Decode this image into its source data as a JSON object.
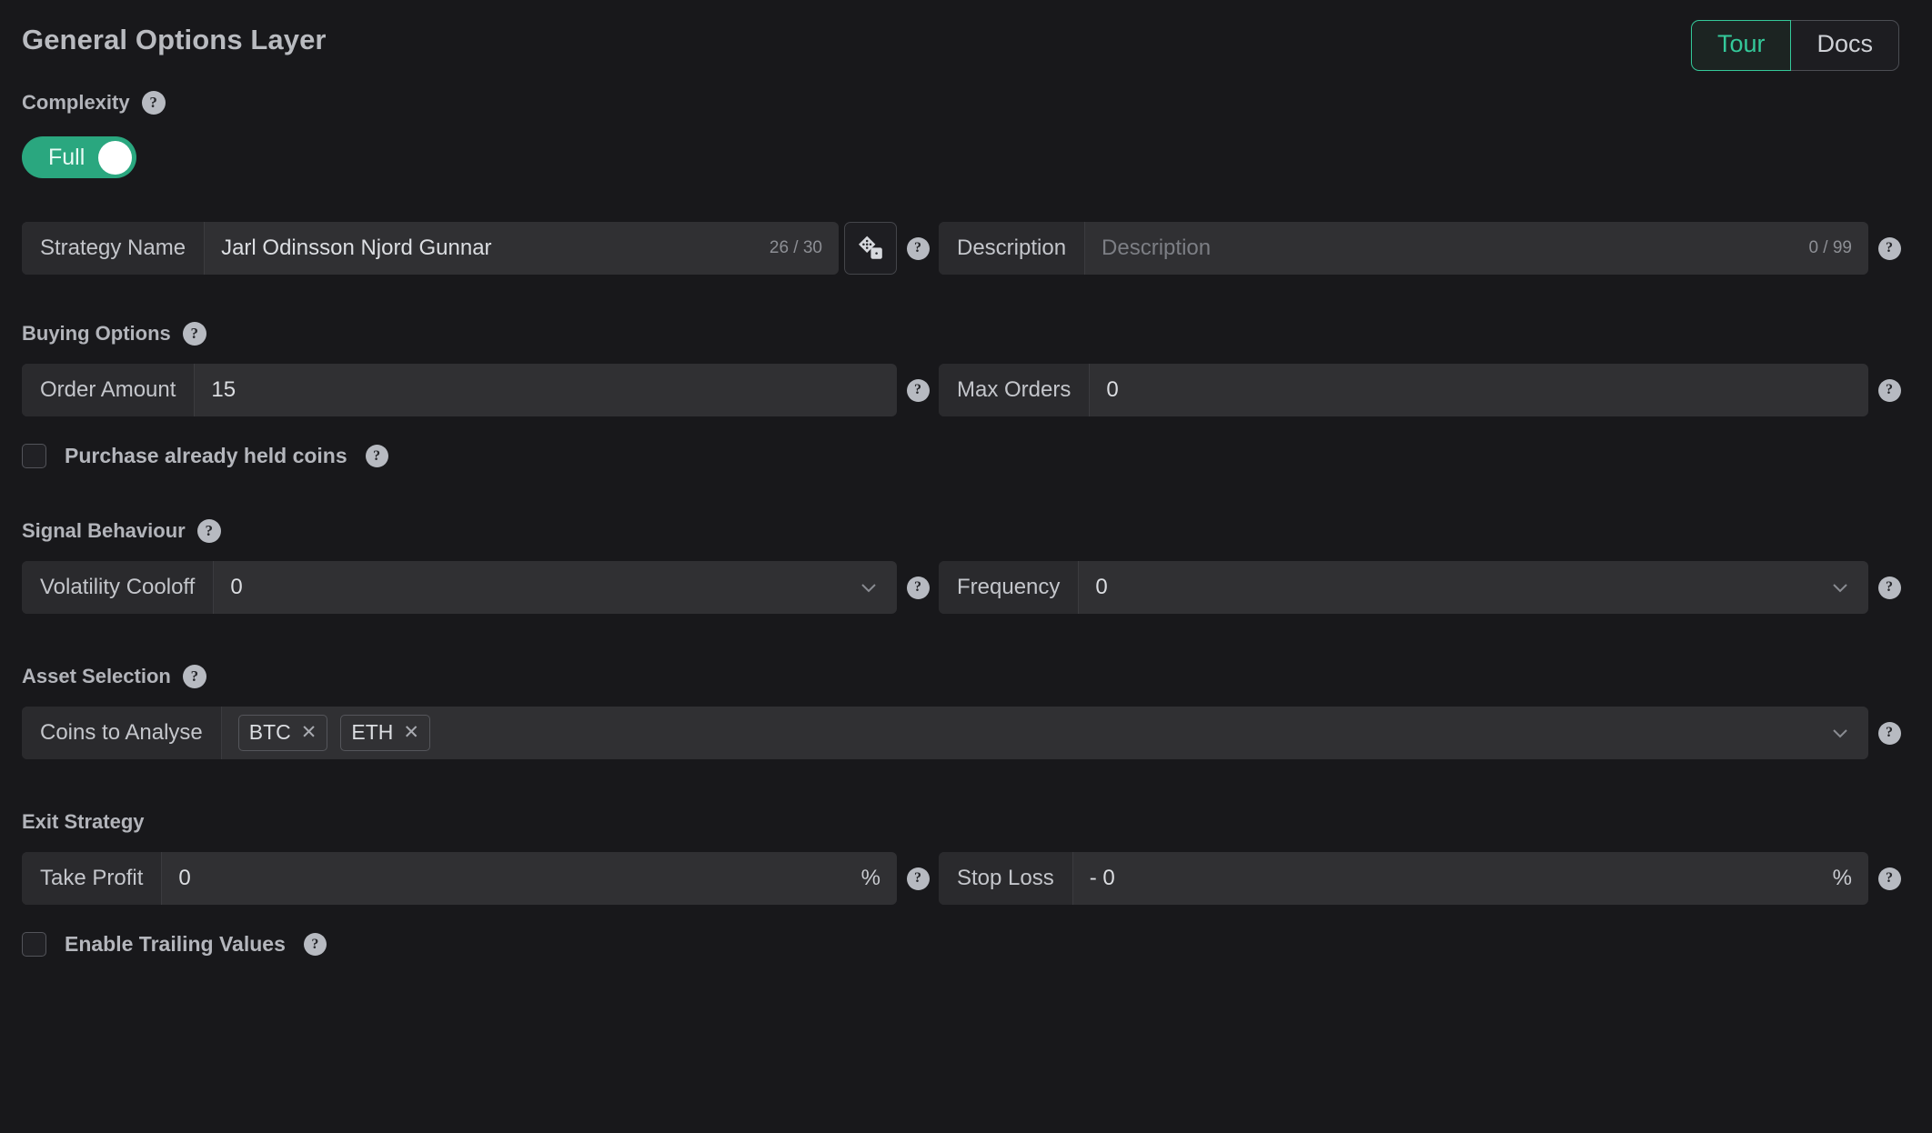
{
  "header": {
    "title": "General Options Layer",
    "buttons": [
      {
        "label": "Tour",
        "active": true
      },
      {
        "label": "Docs",
        "active": false
      }
    ]
  },
  "colors": {
    "page_bg": "#18181b",
    "field_bg": "#303033",
    "field_label_bg": "#2a2a2d",
    "accent_teal": "#34c99a",
    "toggle_on": "#2aa77f",
    "text_primary": "#dcdee2",
    "text_muted": "#8d8f95",
    "heading": "#b2b4ba"
  },
  "icons": {
    "help": "?",
    "dice": "dice-icon",
    "chevron_down": "chevron-down-icon",
    "chip_remove": "✕"
  },
  "complexity": {
    "heading": "Complexity",
    "toggle_label": "Full",
    "toggle_on": true
  },
  "identity": {
    "strategy_name": {
      "label": "Strategy Name",
      "value": "Jarl Odinsson Njord Gunnar",
      "counter": "26 / 30",
      "max": 30,
      "used": 26
    },
    "description": {
      "label": "Description",
      "value": "",
      "placeholder": "Description",
      "counter": "0 / 99",
      "max": 99,
      "used": 0
    }
  },
  "buying_options": {
    "heading": "Buying Options",
    "order_amount": {
      "label": "Order Amount",
      "value": "15"
    },
    "max_orders": {
      "label": "Max Orders",
      "value": "0"
    },
    "purchase_held_coins": {
      "label": "Purchase already held coins",
      "checked": false
    }
  },
  "signal_behaviour": {
    "heading": "Signal Behaviour",
    "volatility_cooloff": {
      "label": "Volatility Cooloff",
      "value": "0"
    },
    "frequency": {
      "label": "Frequency",
      "value": "0"
    }
  },
  "asset_selection": {
    "heading": "Asset Selection",
    "coins_to_analyse": {
      "label": "Coins to Analyse",
      "chips": [
        {
          "label": "BTC"
        },
        {
          "label": "ETH"
        }
      ]
    }
  },
  "exit_strategy": {
    "heading": "Exit Strategy",
    "take_profit": {
      "label": "Take Profit",
      "value": "0",
      "suffix": "%"
    },
    "stop_loss": {
      "label": "Stop Loss",
      "value": "- 0",
      "suffix": "%"
    },
    "enable_trailing_values": {
      "label": "Enable Trailing Values",
      "checked": false
    }
  }
}
